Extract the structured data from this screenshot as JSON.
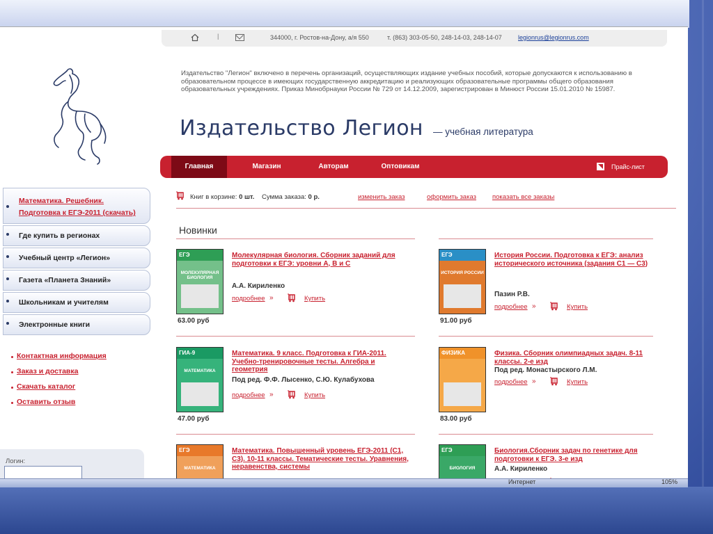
{
  "topbar": {
    "address": "344000, г. Ростов-на-Дону, а/я 550",
    "phones": "т. (863) 303-05-50, 248-14-03, 248-14-07",
    "email": "legionrus@legionrus.com",
    "separator": "|"
  },
  "notice": "Издательство \"Легион\" включено в перечень организаций, осуществляющих издание учебных пособий, которые допускаются к использованию в образовательном процессе в имеющих государственную аккредитацию и реализующих образовательные программы общего образования образовательных учреждениях. Приказ Минобрнауки России № 729 от 14.12.2009, зарегистрирован в Минюст России 15.01.2010 № 15987.",
  "header": {
    "title": "Издательство Легион",
    "subtitle": "— учебная литература"
  },
  "nav": {
    "items": [
      "Главная",
      "Магазин",
      "Авторам",
      "Оптовикам"
    ],
    "price_list": "Прайс-лист"
  },
  "sidebar": {
    "items": [
      "Математика. Решебник. Подготовка к ЕГЭ-2011 (скачать)",
      "Где купить в регионах",
      "Учебный центр «Легион»",
      "Газета «Планета Знаний»",
      "Школьникам и учителям",
      "Электронные книги"
    ],
    "links": [
      "Контактная информация",
      "Заказ и доставка",
      "Скачать каталог",
      "Оставить отзыв"
    ],
    "login_label": "Логин:"
  },
  "cart": {
    "books_label": "Книг в корзине:",
    "books_value": "0 шт.",
    "sum_label": "Сумма заказа:",
    "sum_value": "0 р.",
    "change": "изменить заказ",
    "checkout": "оформить заказ",
    "show_all": "показать все заказы"
  },
  "section_title": "Новинки",
  "product_links": {
    "more": "подробнее",
    "raquo": "»",
    "buy": "Купить"
  },
  "products": [
    {
      "name": "Молекулярная биология. Сборник заданий для подготовки к ЕГЭ: уровни А, В и С",
      "author": "А.А. Кириленко",
      "price": "63.00 руб",
      "cover_band": "ЕГЭ",
      "cover_title": "МОЛЕКУЛЯРНАЯ БИОЛОГИЯ",
      "colors": {
        "band": "#2e9e55",
        "body": "#74c08a"
      }
    },
    {
      "name": "История России. Подготовка к ЕГЭ: анализ исторического источника (задания С1 — С3)",
      "author": "Пазин Р.В.",
      "price": "91.00 руб",
      "cover_band": "ЕГЭ",
      "cover_title": "ИСТОРИЯ РОССИИ",
      "colors": {
        "band": "#2a8fc6",
        "body": "#e07a2e"
      }
    },
    {
      "name": "Математика. 9 класс. Подготовка к ГИА-2011. Учебно-тренировочные тесты. Алгебра и геометрия",
      "author": "Под ред. Ф.Ф. Лысенко, С.Ю. Кулабухова",
      "price": "47.00 руб",
      "cover_band": "ГИА-9",
      "cover_title": "МАТЕМАТИКА",
      "colors": {
        "band": "#1a9a63",
        "body": "#36b37b"
      }
    },
    {
      "name": "Физика. Сборник олимпиадных задач. 8-11 классы. 2-е изд",
      "author": "Под ред. Монастырского Л.М.",
      "price": "83.00 руб",
      "cover_band": "ФИЗИКА",
      "cover_title": "",
      "colors": {
        "band": "#f0922a",
        "body": "#f5a848"
      }
    },
    {
      "name": "Математика. Повышенный уровень ЕГЭ-2011 (С1, С3). 10-11 классы. Тематические тесты. Уравнения, неравенства, системы",
      "author": "",
      "price": "",
      "cover_band": "ЕГЭ",
      "cover_title": "МАТЕМАТИКА",
      "colors": {
        "band": "#e8792a",
        "body": "#f0a05a"
      }
    },
    {
      "name": "Биология.Сборник задач по генетике для подготовки к ЕГЭ. 3-е изд",
      "author": "А.А. Кириленко",
      "price": "",
      "cover_band": "ЕГЭ",
      "cover_title": "БИОЛОГИЯ",
      "colors": {
        "band": "#2e9e55",
        "body": "#3aa867"
      }
    }
  ],
  "statusbar": {
    "zone": "Интернет",
    "zoom": "105%"
  }
}
